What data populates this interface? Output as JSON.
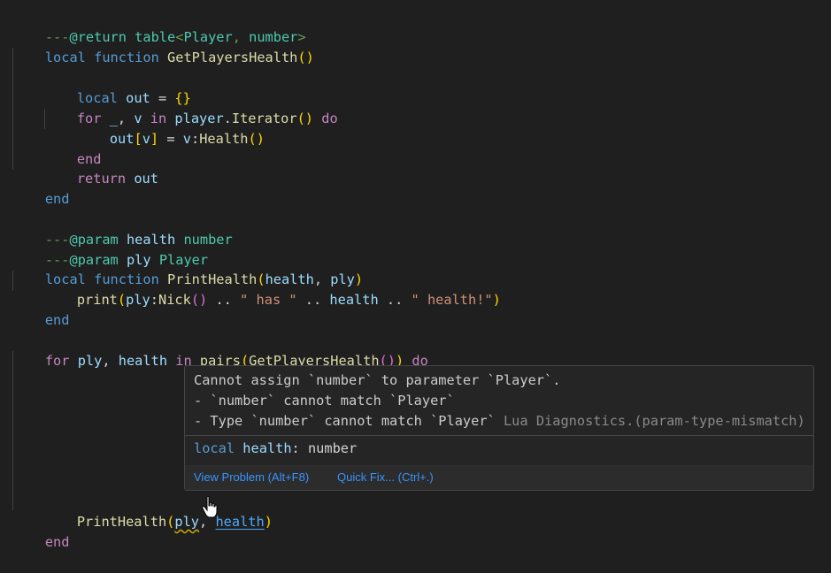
{
  "code": {
    "l1": {
      "p1": "---",
      "p2": "@return",
      "p3": " table",
      "p4": "<",
      "p5": "Player",
      "p6": ", ",
      "p7": "number",
      "p8": ">"
    },
    "l2": {
      "p1": "local",
      "p2": " ",
      "p3": "function",
      "p4": " ",
      "p5": "GetPlayersHealth",
      "p6": "(",
      "p7": ")"
    },
    "l4": {
      "p1": "local",
      "p2": " ",
      "p3": "out",
      "p4": " = ",
      "p5": "{",
      "p6": "}"
    },
    "l5": {
      "p1": "for",
      "p2": " _",
      "p3": ", ",
      "p4": "v",
      "p5": " ",
      "p6": "in",
      "p7": " ",
      "p8": "player",
      "p9": ".",
      "p10": "Iterator",
      "p11": "(",
      "p12": ")",
      "p13": " ",
      "p14": "do"
    },
    "l6": {
      "p1": "out",
      "p2": "[",
      "p3": "v",
      "p4": "]",
      "p5": " = ",
      "p6": "v",
      "p7": ":",
      "p8": "Health",
      "p9": "(",
      "p10": ")"
    },
    "l7": {
      "p1": "end"
    },
    "l8": {
      "p1": "return",
      "p2": " ",
      "p3": "out"
    },
    "l9": {
      "p1": "end"
    },
    "l11": {
      "p1": "---",
      "p2": "@param",
      "p3": " ",
      "p4": "health",
      "p5": " ",
      "p6": "number"
    },
    "l12": {
      "p1": "---",
      "p2": "@param",
      "p3": " ",
      "p4": "ply",
      "p5": " ",
      "p6": "Player"
    },
    "l13": {
      "p1": "local",
      "p2": " ",
      "p3": "function",
      "p4": " ",
      "p5": "PrintHealth",
      "p6": "(",
      "p7": "health",
      "p8": ", ",
      "p9": "ply",
      "p10": ")"
    },
    "l14": {
      "p1": "print",
      "p2": "(",
      "p3": "ply",
      "p4": ":",
      "p5": "Nick",
      "p6": "(",
      "p7": ")",
      "p8": " .. ",
      "p9": "\" has \"",
      "p10": " .. ",
      "p11": "health",
      "p12": " .. ",
      "p13": "\" health!\"",
      "p14": ")"
    },
    "l15": {
      "p1": "end"
    },
    "l17": {
      "p1": "for",
      "p2": " ",
      "p3": "ply",
      "p4": ", ",
      "p5": "health",
      "p6": " ",
      "p7": "in",
      "p8": " ",
      "p9": "pairs",
      "p10": "(",
      "p11": "GetPlayersHealth",
      "p12": "(",
      "p13": ")",
      "p14": ")",
      "p15": " ",
      "p16": "do"
    },
    "l25": {
      "p1": "PrintHealth",
      "p2": "(",
      "p3": "ply",
      "p4": ", ",
      "p5": "health",
      "p6": ")"
    },
    "l26": {
      "p1": "end"
    }
  },
  "hover": {
    "line1": "Cannot assign `number` to parameter `Player`.",
    "line2": "- `number` cannot match `Player`",
    "line3": "- Type `number` cannot match `Player`",
    "source": " Lua Diagnostics.(param-type-mismatch)",
    "decl_kw": "local",
    "decl_name": "health",
    "decl_colon": ": ",
    "decl_type": "number",
    "view_problem": "View Problem (Alt+F8)",
    "quick_fix": "Quick Fix... (Ctrl+.)"
  },
  "icons": {
    "pointer": "hand-pointer-icon"
  }
}
